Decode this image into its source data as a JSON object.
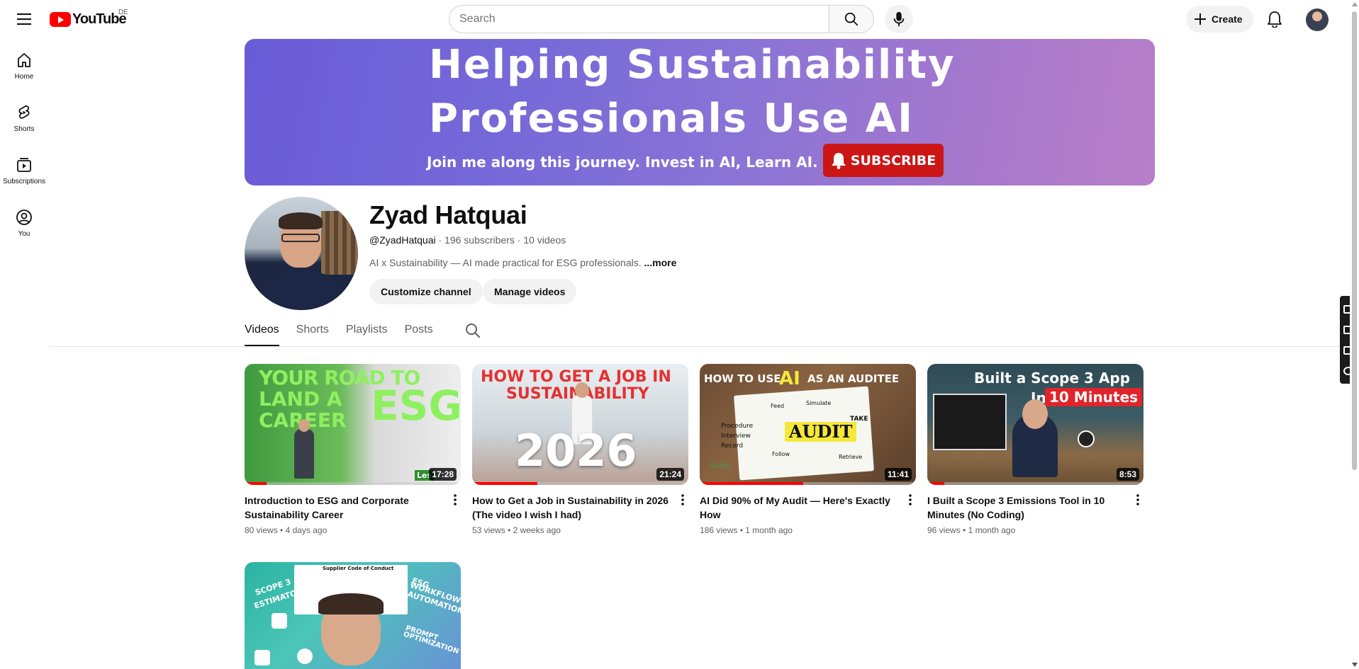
{
  "topbar": {
    "logo_text": "YouTube",
    "country_code": "DE",
    "search_placeholder": "Search",
    "create_label": "Create"
  },
  "guide": {
    "items": [
      {
        "label": "Home",
        "icon": "home-icon"
      },
      {
        "label": "Shorts",
        "icon": "shorts-icon"
      },
      {
        "label": "Subscriptions",
        "icon": "subscriptions-icon"
      },
      {
        "label": "You",
        "icon": "you-icon"
      }
    ]
  },
  "banner": {
    "line1": "Helping Sustainability",
    "line2": "Professionals Use AI",
    "line3": "Join me along this journey. Invest in AI, Learn AI.",
    "subscribe": "SUBSCRIBE"
  },
  "channel": {
    "name": "Zyad Hatquai",
    "handle": "@ZyadHatquai",
    "subscribers": "196 subscribers",
    "videos_count": "10 videos",
    "description": "AI x Sustainability — AI made practical for ESG professionals.",
    "more": "...more",
    "customize_label": "Customize channel",
    "manage_label": "Manage videos"
  },
  "tabs": [
    "Videos",
    "Shorts",
    "Playlists",
    "Posts"
  ],
  "active_tab": "Videos",
  "videos": [
    {
      "title": "Introduction to ESG and Corporate Sustainability Career",
      "views": "80 views",
      "age": "4 days ago",
      "duration": "17:28",
      "progress": 0.1,
      "thumb_text": [
        "YOUR ROAD TO",
        "LAND A",
        "CAREER",
        "ESG"
      ],
      "thumb_badge": "Les"
    },
    {
      "title": "How to Get a Job in Sustainability in 2026 (The video I wish I had)",
      "views": "53 views",
      "age": "2 weeks ago",
      "duration": "21:24",
      "progress": 0.3,
      "thumb_text": [
        "HOW TO GET A JOB IN",
        "SUSTAINABILITY",
        "2026"
      ]
    },
    {
      "title": "AI Did 90% of My Audit — Here's Exactly How",
      "views": "186 views",
      "age": "1 month ago",
      "duration": "11:41",
      "progress": 0.48,
      "thumb_text": [
        "HOW TO USE",
        "AI",
        "AS AN AUDITEE",
        "AUDIT",
        "Procedure",
        "Interview",
        "Record",
        "Feed",
        "Simulate",
        "TAKE",
        "Follow",
        "Retrieve",
        "Quality"
      ]
    },
    {
      "title": "I Built a Scope 3 Emissions Tool in 10 Minutes (No Coding)",
      "views": "96 views",
      "age": "1 month ago",
      "duration": "8:53",
      "progress": 0.08,
      "thumb_text": [
        "Built a Scope 3 App",
        "In",
        "10 Minutes"
      ]
    },
    {
      "title": "",
      "views": "",
      "age": "",
      "duration": "",
      "thumb_text": [
        "Supplier Code of Conduct",
        "SCOPE 3",
        "ESTIMATOR",
        "ESG",
        "WORKFLOW",
        "AUTOMATION",
        "PROMPT",
        "OPTIMIZATION"
      ]
    }
  ],
  "colors": {
    "brand_red": "#ff0000",
    "banner_start": "#6a5bd7",
    "banner_end": "#b87fc8",
    "subscribe_red": "#cc1616"
  }
}
